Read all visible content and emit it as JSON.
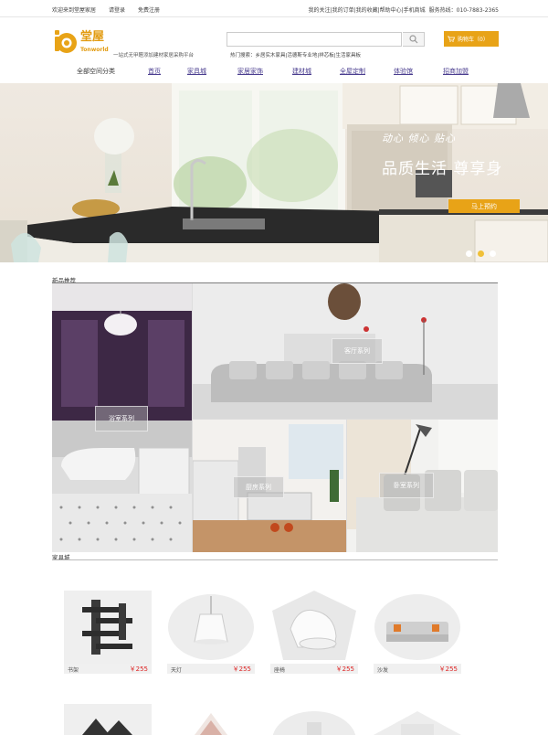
{
  "topbar": {
    "welcome": "欢迎来到堂屋家居",
    "login": "请登录",
    "register": "免费注册",
    "links": [
      "我的关注",
      "|我的订单",
      "|我的收藏",
      "|帮助中心",
      "|手机商城",
      "服务热线：010-7883-2365"
    ]
  },
  "brand": {
    "logo_cn": "堂屋",
    "logo_en": "Tonworld",
    "tagline": "一站式无甲醛添加建材家居采购平台"
  },
  "search": {
    "placeholder": "",
    "hot_text": "热门搜索：乡居实木家具|活德斯专业地|祥芯板|生活家具板"
  },
  "cart": {
    "label": "购物车（0）"
  },
  "nav": {
    "all_categories": "全部空间分类",
    "items": [
      "首页",
      "家具城",
      "家居家饰",
      "建材城",
      "全屋定制",
      "体验馆",
      "招商加盟"
    ]
  },
  "banner": {
    "slogan1": "动心 倾心 贴心",
    "slogan2": "品质生活    尊享身",
    "button": "马上预约",
    "dots": 3,
    "active_dot": 1
  },
  "new_products": {
    "title": "新品推荐",
    "tiles": [
      "浴室系列",
      "客厅系列",
      "厨房系列",
      "卧室系列"
    ]
  },
  "furniture": {
    "title": "家具城",
    "items": [
      {
        "name": "书架",
        "price": "￥255"
      },
      {
        "name": "天灯",
        "price": "￥255"
      },
      {
        "name": "座椅",
        "price": "￥255"
      },
      {
        "name": "沙发",
        "price": "￥255"
      }
    ]
  },
  "colors": {
    "accent": "#e8a317",
    "nav_link": "#4a3d8f",
    "price": "#dd2222"
  }
}
